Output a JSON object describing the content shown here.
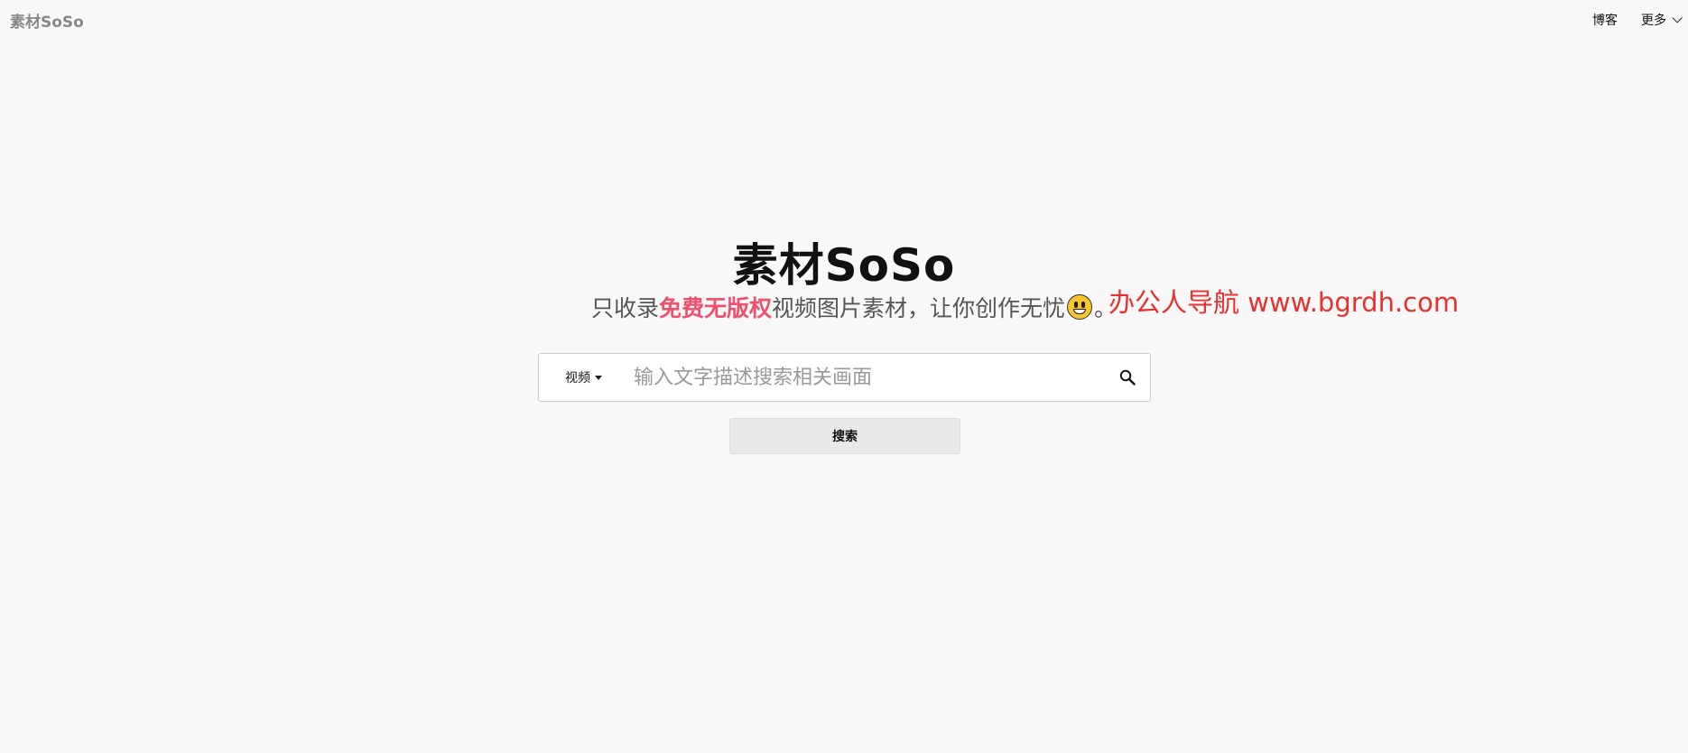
{
  "header": {
    "brand": "素材SoSo",
    "nav": {
      "blog": "博客",
      "more": "更多"
    }
  },
  "hero": {
    "title": "素材SoSo",
    "tagline_prefix": "只收录",
    "tagline_highlight": "免费无版权",
    "tagline_suffix": "视频图片素材，让你创作无忧",
    "tagline_end": "。",
    "emoji": "grinning-face-icon"
  },
  "watermark": "办公人导航 www.bgrdh.com",
  "search": {
    "type_selected": "视频",
    "placeholder": "输入文字描述搜索相关画面",
    "value": "",
    "button_label": "搜索"
  },
  "colors": {
    "highlight": "#f0506e",
    "watermark": "#e8302e",
    "background": "#f8f8f8"
  }
}
